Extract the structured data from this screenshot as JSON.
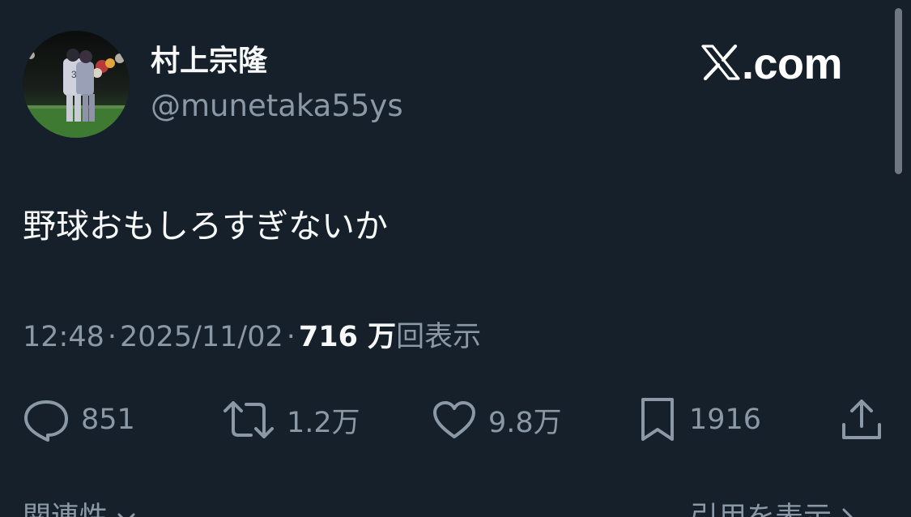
{
  "author": {
    "display_name": "村上宗隆",
    "handle": "@munetaka55ys"
  },
  "brand": {
    "text": ".com",
    "icon": "x-logo-icon"
  },
  "tweet": {
    "text": "野球おもしろすぎないか",
    "time": "12:48",
    "date": "2025/11/02",
    "separator": "·",
    "views_count": "716 万",
    "views_label": "回表示"
  },
  "actions": {
    "reply": {
      "icon": "reply-icon",
      "count": "851"
    },
    "repost": {
      "icon": "repost-icon",
      "count": "1.2万"
    },
    "like": {
      "icon": "heart-icon",
      "count": "9.8万"
    },
    "bookmark": {
      "icon": "bookmark-icon",
      "count": "1916"
    },
    "share": {
      "icon": "share-icon"
    }
  },
  "footer": {
    "related_label": "関連性",
    "quotes_label": "引用を表示"
  },
  "colors": {
    "background": "#15202b",
    "primary_text": "#f7f9f9",
    "secondary_text": "#8b98a5"
  }
}
